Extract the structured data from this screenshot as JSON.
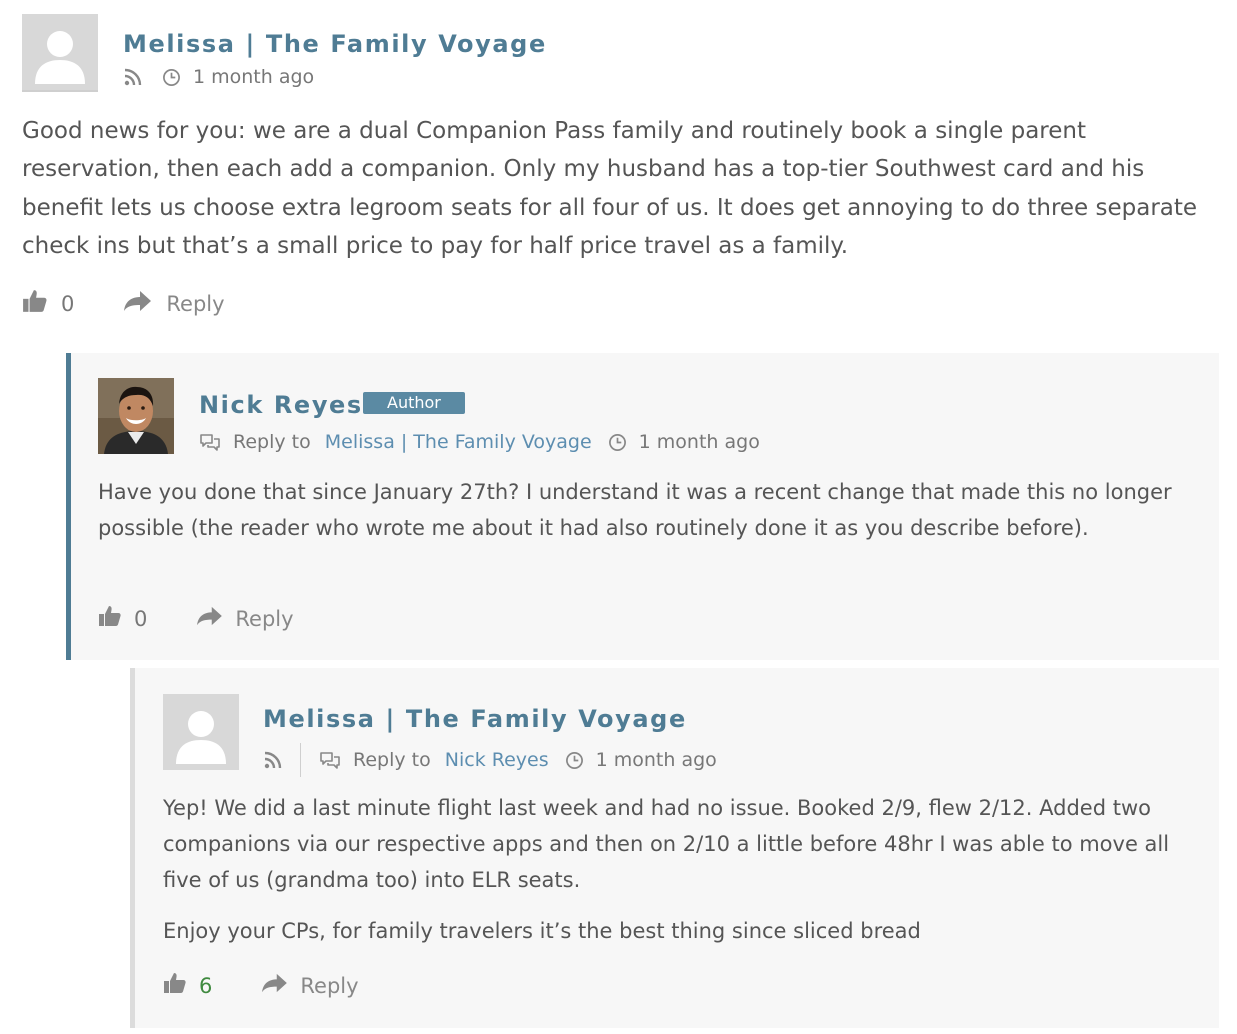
{
  "comments": [
    {
      "author": "Melissa | The Family Voyage",
      "time": "1 month ago",
      "body": [
        "Good news for you: we are a dual Companion Pass family and routinely book a single parent reservation, then each add a companion. Only my husband has a top-tier Southwest card and his benefit lets us choose extra legroom seats for all four of us. It does get annoying to do three separate check ins but that’s a small price to pay for half price travel as a family."
      ],
      "likes": "0",
      "reply_label": "Reply"
    },
    {
      "author": "Nick Reyes",
      "badge": "Author",
      "reply_to_label": "Reply to",
      "reply_to": "Melissa | The Family Voyage",
      "time": "1 month ago",
      "body": [
        "Have you done that since January 27th? I understand it was a recent change that made this no longer possible (the reader who wrote me about it had also routinely done it as you describe before)."
      ],
      "likes": "0",
      "reply_label": "Reply"
    },
    {
      "author": "Melissa | The Family Voyage",
      "reply_to_label": "Reply to",
      "reply_to": "Nick Reyes",
      "time": "1 month ago",
      "body": [
        "Yep! We did a last minute flight last week and had no issue. Booked 2/9, flew 2/12. Added two companions via our respective apps and then on 2/10 a little before 48hr I was able to move all five of us (grandma too) into ELR seats.",
        "Enjoy your CPs, for family travelers it’s the best thing since sliced bread"
      ],
      "likes": "6",
      "reply_label": "Reply"
    }
  ],
  "colors": {
    "author": "#4f7c94",
    "link": "#5d8eb0",
    "badge": "#5b8aa3",
    "thread_border": "#4f7c94",
    "positive_count": "#3f8a3f"
  },
  "icons": [
    "rss-icon",
    "clock-icon",
    "chat-bubbles-icon",
    "thumbs-up-icon",
    "share-arrow-icon"
  ]
}
